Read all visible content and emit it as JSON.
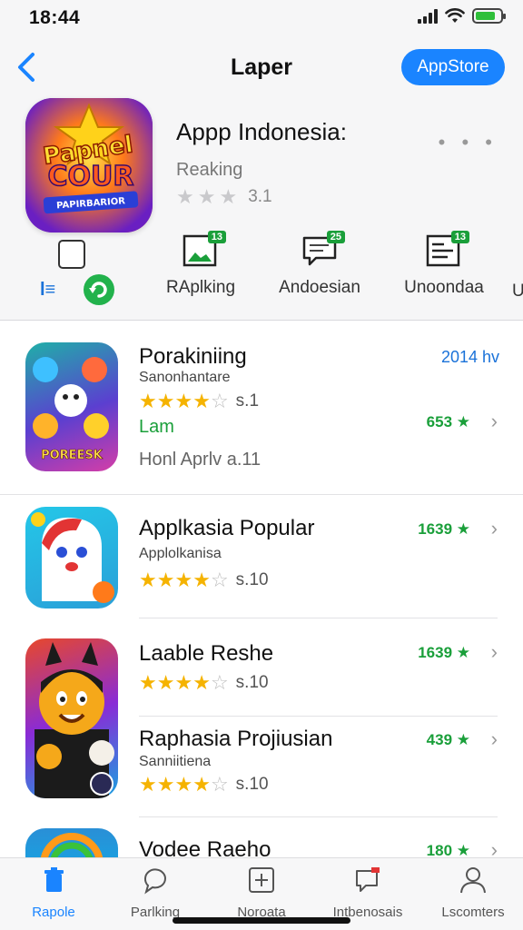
{
  "status": {
    "time": "18:44"
  },
  "header": {
    "title": "Laper",
    "button": "AppStore"
  },
  "hero": {
    "icon_text_1": "Papnel",
    "icon_text_2": "COUR",
    "icon_text_3": "PAPIRBARIOR",
    "title": "Appp Indonesia:",
    "subtitle": "Reaking",
    "rating": "3.1",
    "more": "• • •"
  },
  "categories": [
    {
      "label": "RAplking",
      "badge": "13"
    },
    {
      "label": "Andoesian",
      "badge": "25"
    },
    {
      "label": "Unoondaa",
      "badge": "13"
    }
  ],
  "category_edge": "U",
  "list": [
    {
      "title": "Porakiniing",
      "sub": "Sanonhantare",
      "rating": "s.1",
      "extra": "Lam",
      "extra2": "Honl Aprlv a.11",
      "count": "653 ★",
      "top_right": "2014 hv",
      "icon_text": "POREESK"
    },
    {
      "title": "Applkasia Popular",
      "sub": "Applolkanisa",
      "rating": "s.10",
      "count": "1639 ★"
    },
    {
      "title": "Laable Reshe",
      "rating": "s.10",
      "count": "1639 ★"
    },
    {
      "title": "Raphasia Projiusian",
      "sub": "Sanniitiena",
      "rating": "s.10",
      "count": "439 ★"
    },
    {
      "title": "Vodee Raeho",
      "count": "180 ★"
    }
  ],
  "tabs": [
    {
      "label": "Rapole",
      "icon": "trash-icon"
    },
    {
      "label": "Parlking",
      "icon": "chat-icon"
    },
    {
      "label": "Noroata",
      "icon": "plus-square-icon"
    },
    {
      "label": "Intbenosais",
      "icon": "flag-chat-icon"
    },
    {
      "label": "Lscomters",
      "icon": "person-icon"
    }
  ],
  "colors": {
    "accent": "#1a84ff",
    "green": "#1a9f3a",
    "star": "#f5b301"
  }
}
